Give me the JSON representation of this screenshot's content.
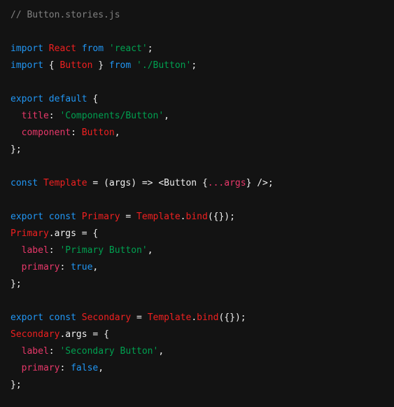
{
  "editor": {
    "filename": "Button.stories.js",
    "language": "javascript",
    "background_color": "#131313",
    "font_size_px": 13,
    "line_height_px": 24
  },
  "theme": {
    "comment": "#808080",
    "keyword": "#2196f3",
    "class": "#f02020",
    "string": "#00a050",
    "property": "#e8386a",
    "plain": "#f0f0f0",
    "background": "#131313"
  },
  "code": {
    "lines": [
      {
        "tokens": [
          {
            "t": "// Button.stories.js",
            "c": "comment"
          }
        ]
      },
      {
        "tokens": []
      },
      {
        "tokens": [
          {
            "t": "import",
            "c": "keyword"
          },
          {
            "t": " ",
            "c": "plain"
          },
          {
            "t": "React",
            "c": "class"
          },
          {
            "t": " ",
            "c": "plain"
          },
          {
            "t": "from",
            "c": "keyword"
          },
          {
            "t": " ",
            "c": "plain"
          },
          {
            "t": "'react'",
            "c": "string"
          },
          {
            "t": ";",
            "c": "plain"
          }
        ]
      },
      {
        "tokens": [
          {
            "t": "import",
            "c": "keyword"
          },
          {
            "t": " { ",
            "c": "plain"
          },
          {
            "t": "Button",
            "c": "class"
          },
          {
            "t": " } ",
            "c": "plain"
          },
          {
            "t": "from",
            "c": "keyword"
          },
          {
            "t": " ",
            "c": "plain"
          },
          {
            "t": "'./Button'",
            "c": "string"
          },
          {
            "t": ";",
            "c": "plain"
          }
        ]
      },
      {
        "tokens": []
      },
      {
        "tokens": [
          {
            "t": "export",
            "c": "keyword"
          },
          {
            "t": " ",
            "c": "plain"
          },
          {
            "t": "default",
            "c": "keyword"
          },
          {
            "t": " {",
            "c": "plain"
          }
        ]
      },
      {
        "tokens": [
          {
            "t": "  ",
            "c": "plain"
          },
          {
            "t": "title",
            "c": "property"
          },
          {
            "t": ": ",
            "c": "plain"
          },
          {
            "t": "'Components/Button'",
            "c": "string"
          },
          {
            "t": ",",
            "c": "plain"
          }
        ]
      },
      {
        "tokens": [
          {
            "t": "  ",
            "c": "plain"
          },
          {
            "t": "component",
            "c": "property"
          },
          {
            "t": ": ",
            "c": "plain"
          },
          {
            "t": "Button",
            "c": "class"
          },
          {
            "t": ",",
            "c": "plain"
          }
        ]
      },
      {
        "tokens": [
          {
            "t": "};",
            "c": "plain"
          }
        ]
      },
      {
        "tokens": []
      },
      {
        "tokens": [
          {
            "t": "const",
            "c": "keyword"
          },
          {
            "t": " ",
            "c": "plain"
          },
          {
            "t": "Template",
            "c": "class"
          },
          {
            "t": " = (args) => <Button {",
            "c": "plain"
          },
          {
            "t": "...args",
            "c": "property"
          },
          {
            "t": "} />;",
            "c": "plain"
          }
        ]
      },
      {
        "tokens": []
      },
      {
        "tokens": [
          {
            "t": "export",
            "c": "keyword"
          },
          {
            "t": " ",
            "c": "plain"
          },
          {
            "t": "const",
            "c": "keyword"
          },
          {
            "t": " ",
            "c": "plain"
          },
          {
            "t": "Primary",
            "c": "class"
          },
          {
            "t": " = ",
            "c": "plain"
          },
          {
            "t": "Template",
            "c": "class"
          },
          {
            "t": ".",
            "c": "plain"
          },
          {
            "t": "bind",
            "c": "class"
          },
          {
            "t": "({});",
            "c": "plain"
          }
        ]
      },
      {
        "tokens": [
          {
            "t": "Primary",
            "c": "class"
          },
          {
            "t": ".args = {",
            "c": "plain"
          }
        ]
      },
      {
        "tokens": [
          {
            "t": "  ",
            "c": "plain"
          },
          {
            "t": "label",
            "c": "property"
          },
          {
            "t": ": ",
            "c": "plain"
          },
          {
            "t": "'Primary Button'",
            "c": "string"
          },
          {
            "t": ",",
            "c": "plain"
          }
        ]
      },
      {
        "tokens": [
          {
            "t": "  ",
            "c": "plain"
          },
          {
            "t": "primary",
            "c": "property"
          },
          {
            "t": ": ",
            "c": "plain"
          },
          {
            "t": "true",
            "c": "keyword"
          },
          {
            "t": ",",
            "c": "plain"
          }
        ]
      },
      {
        "tokens": [
          {
            "t": "};",
            "c": "plain"
          }
        ]
      },
      {
        "tokens": []
      },
      {
        "tokens": [
          {
            "t": "export",
            "c": "keyword"
          },
          {
            "t": " ",
            "c": "plain"
          },
          {
            "t": "const",
            "c": "keyword"
          },
          {
            "t": " ",
            "c": "plain"
          },
          {
            "t": "Secondary",
            "c": "class"
          },
          {
            "t": " = ",
            "c": "plain"
          },
          {
            "t": "Template",
            "c": "class"
          },
          {
            "t": ".",
            "c": "plain"
          },
          {
            "t": "bind",
            "c": "class"
          },
          {
            "t": "({});",
            "c": "plain"
          }
        ]
      },
      {
        "tokens": [
          {
            "t": "Secondary",
            "c": "class"
          },
          {
            "t": ".args = {",
            "c": "plain"
          }
        ]
      },
      {
        "tokens": [
          {
            "t": "  ",
            "c": "plain"
          },
          {
            "t": "label",
            "c": "property"
          },
          {
            "t": ": ",
            "c": "plain"
          },
          {
            "t": "'Secondary Button'",
            "c": "string"
          },
          {
            "t": ",",
            "c": "plain"
          }
        ]
      },
      {
        "tokens": [
          {
            "t": "  ",
            "c": "plain"
          },
          {
            "t": "primary",
            "c": "property"
          },
          {
            "t": ": ",
            "c": "plain"
          },
          {
            "t": "false",
            "c": "keyword"
          },
          {
            "t": ",",
            "c": "plain"
          }
        ]
      },
      {
        "tokens": [
          {
            "t": "};",
            "c": "plain"
          }
        ]
      }
    ]
  }
}
